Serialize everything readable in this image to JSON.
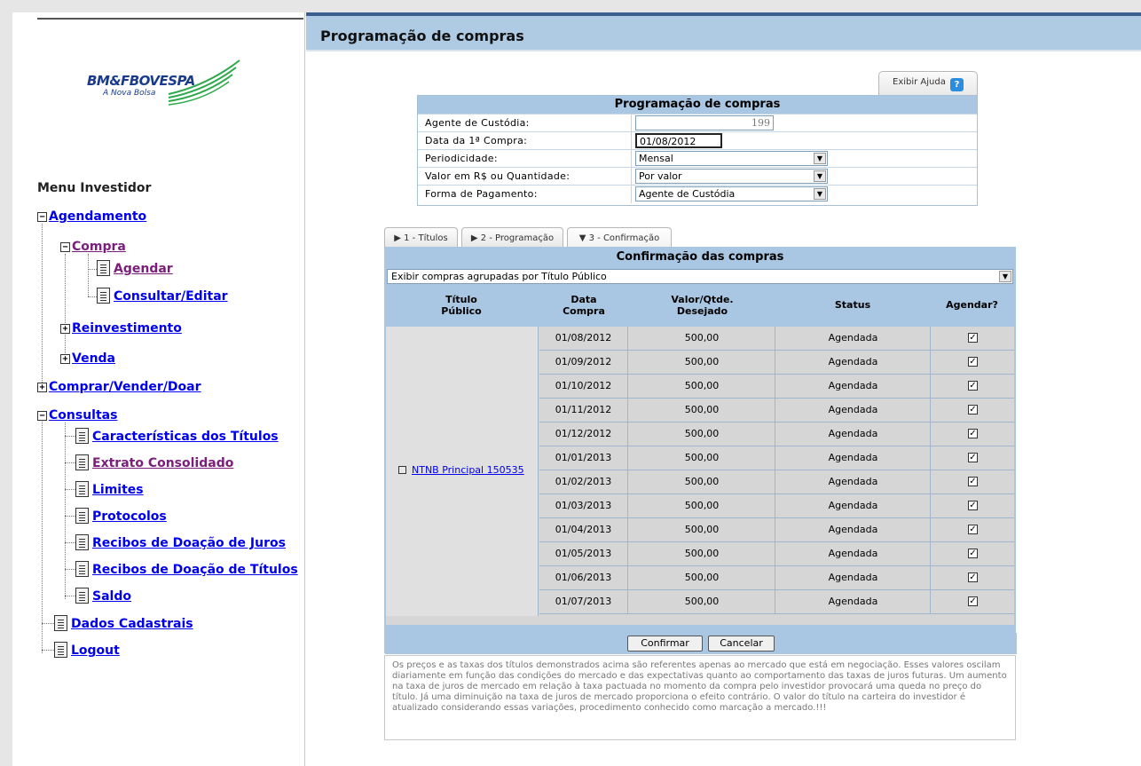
{
  "sidebar": {
    "logo": {
      "name": "BM&FBOVESPA",
      "tagline": "A Nova Bolsa"
    },
    "menu_title": "Menu Investidor",
    "items": {
      "agendamento": "Agendamento",
      "compra": "Compra",
      "agendar": "Agendar",
      "consultar_editar": "Consultar/Editar",
      "reinvestimento": "Reinvestimento",
      "venda": "Venda",
      "comprar_vender_doar": "Comprar/Vender/Doar",
      "consultas": "Consultas",
      "caracteristicas": "Características dos Títulos",
      "extrato": "Extrato Consolidado",
      "limites": "Limites",
      "protocolos": "Protocolos",
      "recibos_juros": "Recibos de Doação de Juros",
      "recibos_titulos": "Recibos de Doação de Títulos",
      "saldo": "Saldo",
      "dados_cadastrais": "Dados Cadastrais",
      "logout": "Logout"
    },
    "toggles": {
      "expanded": "−",
      "collapsed": "+"
    }
  },
  "main": {
    "page_title": "Programação de compras",
    "help_button": "Exibir Ajuda",
    "help_icon": "?",
    "form": {
      "title": "Programação de compras",
      "agente_label": "Agente de Custódia:",
      "agente_value": "199",
      "data_label": "Data da 1ª Compra:",
      "data_value": "01/08/2012",
      "periodicidade_label": "Periodicidade:",
      "periodicidade_value": "Mensal",
      "valor_label": "Valor em R$ ou Quantidade:",
      "valor_value": "Por valor",
      "pagamento_label": "Forma de Pagamento:",
      "pagamento_value": "Agente de Custódia"
    },
    "tabs": {
      "t1": "▶ 1 - Títulos",
      "t2": "▶ 2 - Programação",
      "t3": "▼ 3 - Confirmação"
    },
    "confirmation": {
      "title": "Confirmação das compras",
      "group_select": "Exibir compras agrupadas por Título Público",
      "headers": {
        "titulo_l1": "Título",
        "titulo_l2": "Público",
        "data_l1": "Data",
        "data_l2": "Compra",
        "valor_l1": "Valor/Qtde.",
        "valor_l2": "Desejado",
        "status": "Status",
        "agendar": "Agendar?"
      },
      "titulo": "NTNB Principal 150535",
      "rows": [
        {
          "date": "01/08/2012",
          "value": "500,00",
          "status": "Agendada",
          "checked": "✓"
        },
        {
          "date": "01/09/2012",
          "value": "500,00",
          "status": "Agendada",
          "checked": "✓"
        },
        {
          "date": "01/10/2012",
          "value": "500,00",
          "status": "Agendada",
          "checked": "✓"
        },
        {
          "date": "01/11/2012",
          "value": "500,00",
          "status": "Agendada",
          "checked": "✓"
        },
        {
          "date": "01/12/2012",
          "value": "500,00",
          "status": "Agendada",
          "checked": "✓"
        },
        {
          "date": "01/01/2013",
          "value": "500,00",
          "status": "Agendada",
          "checked": "✓"
        },
        {
          "date": "01/02/2013",
          "value": "500,00",
          "status": "Agendada",
          "checked": "✓"
        },
        {
          "date": "01/03/2013",
          "value": "500,00",
          "status": "Agendada",
          "checked": "✓"
        },
        {
          "date": "01/04/2013",
          "value": "500,00",
          "status": "Agendada",
          "checked": "✓"
        },
        {
          "date": "01/05/2013",
          "value": "500,00",
          "status": "Agendada",
          "checked": "✓"
        },
        {
          "date": "01/06/2013",
          "value": "500,00",
          "status": "Agendada",
          "checked": "✓"
        },
        {
          "date": "01/07/2013",
          "value": "500,00",
          "status": "Agendada",
          "checked": "✓"
        }
      ],
      "confirm_button": "Confirmar",
      "cancel_button": "Cancelar"
    },
    "footnote": "Os preços e as taxas dos títulos demonstrados acima são referentes apenas ao mercado que está em negociação. Esses valores oscilam diariamente em função das condições do mercado e das expectativas quanto ao comportamento das taxas de juros futuras. Um aumento na taxa de juros de mercado em relação à taxa pactuada no momento da compra pelo investidor provocará uma queda no preço do título. Já uma diminuição na taxa de juros de mercado proporciona o efeito contrário. O valor do título na carteira do investidor é atualizado considerando essas variações, procedimento conhecido como marcação a mercado.!!!"
  },
  "colors": {
    "header_blue": "#a9c6e2",
    "titlebar_blue": "#aecbe3",
    "link_blue": "#0000ee",
    "visited_purple": "#7b1e7b",
    "row_gray": "#d6d6d6"
  }
}
